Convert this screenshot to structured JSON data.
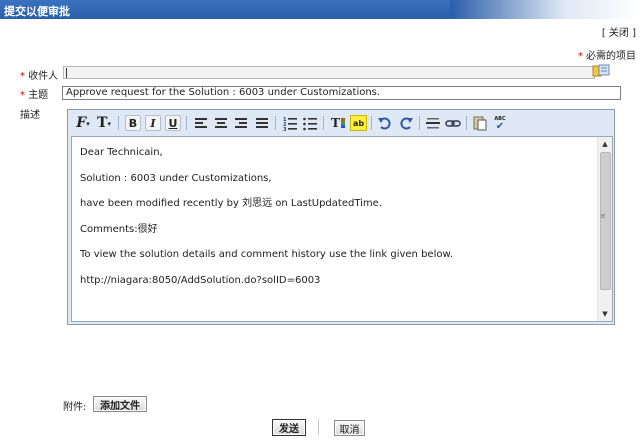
{
  "window": {
    "title": "提交以便审批"
  },
  "links": {
    "close": "关闭",
    "close_open": "[ ",
    "close_close": " ]"
  },
  "form": {
    "required_star": "*",
    "required_note": "必需的项目",
    "recipient_label": "收件人",
    "recipient_value": "",
    "subject_label": "主题",
    "subject_value": "Approve request for the Solution : 6003 under Customizations.",
    "description_label": "描述"
  },
  "toolbar": {
    "font_label": "F",
    "font_size_label": "T",
    "bold_label": "B",
    "italic_label": "I",
    "underline_label": "U",
    "text_color_label": "T",
    "highlight_label": "ab",
    "spellcheck_label": "ABC",
    "icons": [
      "font-family-icon",
      "font-size-icon",
      "bold-icon",
      "italic-icon",
      "underline-icon",
      "align-left-icon",
      "align-center-icon",
      "align-right-icon",
      "justify-icon",
      "numbered-list-icon",
      "bullet-list-icon",
      "text-color-icon",
      "highlight-icon",
      "undo-icon",
      "redo-icon",
      "horizontal-rule-icon",
      "link-icon",
      "paste-icon",
      "spellcheck-icon"
    ]
  },
  "message": {
    "lines": [
      "Dear Technicain,",
      "Solution : 6003 under Customizations,",
      "have been modified recently by 刘思远  on LastUpdatedTime.",
      "Comments:很好",
      "To view the solution details and comment history use the link given below.",
      "http://niagara:8050/AddSolution.do?solID=6003"
    ]
  },
  "attachments": {
    "label": "附件:",
    "add_button": "添加文件"
  },
  "actions": {
    "send": "发送",
    "cancel": "取消"
  },
  "scrollbar": {
    "up": "▲",
    "down": "▼",
    "grip": "≡"
  },
  "colors": {
    "titlebar": "#2a5ea9",
    "required": "#d40000",
    "toolbar_bg": "#dfe9f5"
  }
}
